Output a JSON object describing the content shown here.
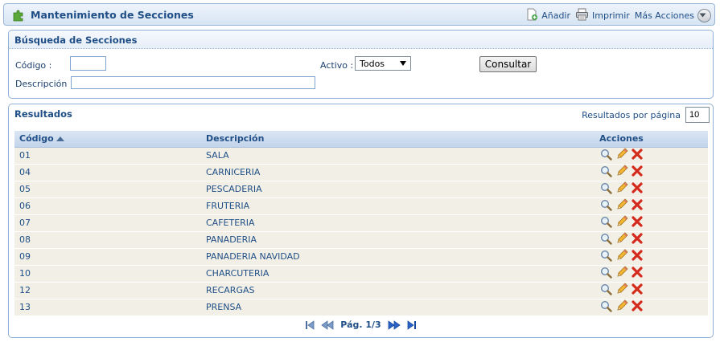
{
  "header": {
    "title": "Mantenimiento de Secciones",
    "toolbar": {
      "add_label": "Añadir",
      "print_label": "Imprimir",
      "more_label": "Más Acciones"
    }
  },
  "search": {
    "title": "Búsqueda de Secciones",
    "code_label": "Código :",
    "code_value": "",
    "description_label": "Descripción :",
    "description_value": "",
    "active_label": "Activo :",
    "active_selected": "Todos",
    "submit_label": "Consultar"
  },
  "results": {
    "title": "Resultados",
    "per_page_label": "Resultados por página",
    "per_page_value": "10",
    "columns": {
      "code": "Código",
      "description": "Descripción",
      "actions": "Acciones"
    },
    "rows": [
      {
        "code": "01",
        "description": "SALA"
      },
      {
        "code": "04",
        "description": "CARNICERIA"
      },
      {
        "code": "05",
        "description": "PESCADERIA"
      },
      {
        "code": "06",
        "description": "FRUTERIA"
      },
      {
        "code": "07",
        "description": "CAFETERIA"
      },
      {
        "code": "08",
        "description": "PANADERIA"
      },
      {
        "code": "09",
        "description": "PANADERIA NAVIDAD"
      },
      {
        "code": "10",
        "description": "CHARCUTERIA"
      },
      {
        "code": "12",
        "description": "RECARGAS"
      },
      {
        "code": "13",
        "description": "PRENSA"
      }
    ],
    "pagination": {
      "label": "Pág. 1/3"
    }
  },
  "icons": {
    "logo": "puzzle-icon",
    "add": "add-document-icon",
    "print": "printer-icon",
    "more": "chevron-down-circle-icon",
    "view": "magnifier-icon",
    "edit": "pencil-icon",
    "delete": "red-cross-icon"
  },
  "colors": {
    "title_text": "#1f4e86",
    "panel_border": "#8fb0d6",
    "row_background": "#f2f0e6",
    "delete_icon": "#d42a1e"
  }
}
